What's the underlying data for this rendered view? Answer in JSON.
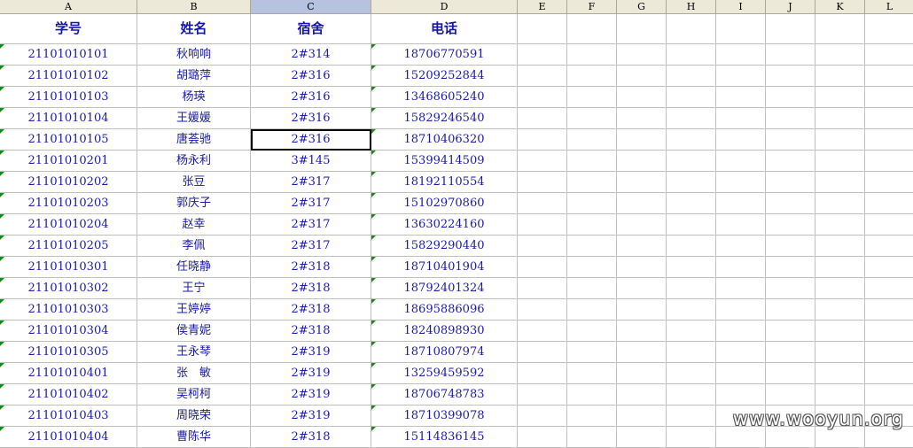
{
  "columns": [
    "A",
    "B",
    "C",
    "D",
    "E",
    "F",
    "G",
    "H",
    "I",
    "J",
    "K",
    "L"
  ],
  "selected_column": "C",
  "headers": [
    "学号",
    "姓名",
    "宿舍",
    "电话"
  ],
  "rows": [
    [
      "21101010101",
      "秋响响",
      "2#314",
      "18706770591"
    ],
    [
      "21101010102",
      "胡璐萍",
      "2#316",
      "15209252844"
    ],
    [
      "21101010103",
      "杨瑛",
      "2#316",
      "13468605240"
    ],
    [
      "21101010104",
      "王媛媛",
      "2#316",
      "15829246540"
    ],
    [
      "21101010105",
      "唐荟驰",
      "2#316",
      "18710406320"
    ],
    [
      "21101010201",
      "杨永利",
      "3#145",
      "15399414509"
    ],
    [
      "21101010202",
      "张豆",
      "2#317",
      "18192110554"
    ],
    [
      "21101010203",
      "郭庆子",
      "2#317",
      "15102970860"
    ],
    [
      "21101010204",
      "赵幸",
      "2#317",
      "13630224160"
    ],
    [
      "21101010205",
      "李佩",
      "2#317",
      "15829290440"
    ],
    [
      "21101010301",
      "任晓静",
      "2#318",
      "18710401904"
    ],
    [
      "21101010302",
      "王宁",
      "2#318",
      "18792401324"
    ],
    [
      "21101010303",
      "王婷婷",
      "2#318",
      "18695886096"
    ],
    [
      "21101010304",
      "侯青妮",
      "2#318",
      "18240898930"
    ],
    [
      "21101010305",
      "王永琴",
      "2#319",
      "18710807974"
    ],
    [
      "21101010401",
      "张　敏",
      "2#319",
      "13259459592"
    ],
    [
      "21101010402",
      "吴柯柯",
      "2#319",
      "18706748783"
    ],
    [
      "21101010403",
      "周晓荣",
      "2#319",
      "18710399078"
    ],
    [
      "21101010404",
      "曹陈华",
      "2#318",
      "15114836145"
    ]
  ],
  "active_cell": "C6",
  "watermark": "www.wooyun.org",
  "colors": {
    "text": "#1a1aa8",
    "header_bg": "#ece9d8",
    "selected_header": "#b6c2e0",
    "flag": "#109010"
  }
}
